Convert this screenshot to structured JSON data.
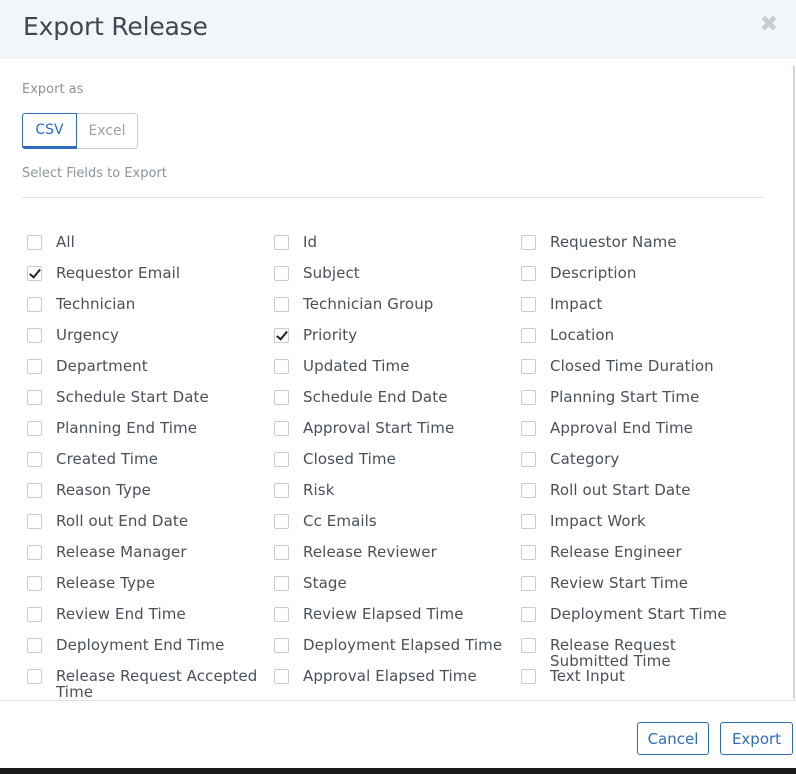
{
  "dialog": {
    "title": "Export Release",
    "close_icon": "close-icon"
  },
  "export_as": {
    "label": "Export as",
    "options": [
      "CSV",
      "Excel"
    ],
    "selected": "CSV"
  },
  "fields_section": {
    "label": "Select Fields to Export"
  },
  "fields": [
    [
      {
        "label": "All",
        "checked": false
      },
      {
        "label": "Id",
        "checked": false
      },
      {
        "label": "Requestor Name",
        "checked": false
      }
    ],
    [
      {
        "label": "Requestor Email",
        "checked": true
      },
      {
        "label": "Subject",
        "checked": false
      },
      {
        "label": "Description",
        "checked": false
      }
    ],
    [
      {
        "label": "Technician",
        "checked": false
      },
      {
        "label": "Technician Group",
        "checked": false
      },
      {
        "label": "Impact",
        "checked": false
      }
    ],
    [
      {
        "label": "Urgency",
        "checked": false
      },
      {
        "label": "Priority",
        "checked": true
      },
      {
        "label": "Location",
        "checked": false
      }
    ],
    [
      {
        "label": "Department",
        "checked": false
      },
      {
        "label": "Updated Time",
        "checked": false
      },
      {
        "label": "Closed Time Duration",
        "checked": false
      }
    ],
    [
      {
        "label": "Schedule Start Date",
        "checked": false
      },
      {
        "label": "Schedule End Date",
        "checked": false
      },
      {
        "label": "Planning Start Time",
        "checked": false
      }
    ],
    [
      {
        "label": "Planning End Time",
        "checked": false
      },
      {
        "label": "Approval Start Time",
        "checked": false
      },
      {
        "label": "Approval End Time",
        "checked": false
      }
    ],
    [
      {
        "label": "Created Time",
        "checked": false
      },
      {
        "label": "Closed Time",
        "checked": false
      },
      {
        "label": "Category",
        "checked": false
      }
    ],
    [
      {
        "label": "Reason Type",
        "checked": false
      },
      {
        "label": "Risk",
        "checked": false
      },
      {
        "label": "Roll out Start Date",
        "checked": false
      }
    ],
    [
      {
        "label": "Roll out End Date",
        "checked": false
      },
      {
        "label": "Cc Emails",
        "checked": false
      },
      {
        "label": "Impact Work",
        "checked": false
      }
    ],
    [
      {
        "label": "Release Manager",
        "checked": false
      },
      {
        "label": "Release Reviewer",
        "checked": false
      },
      {
        "label": "Release Engineer",
        "checked": false
      }
    ],
    [
      {
        "label": "Release Type",
        "checked": false
      },
      {
        "label": "Stage",
        "checked": false
      },
      {
        "label": "Review Start Time",
        "checked": false
      }
    ],
    [
      {
        "label": "Review End Time",
        "checked": false
      },
      {
        "label": "Review Elapsed Time",
        "checked": false
      },
      {
        "label": "Deployment Start Time",
        "checked": false
      }
    ],
    [
      {
        "label": "Deployment End Time",
        "checked": false
      },
      {
        "label": "Deployment Elapsed Time",
        "checked": false
      },
      {
        "label": "Release Request Submitted Time",
        "checked": false
      }
    ],
    [
      {
        "label": "Release Request Accepted Time",
        "checked": false
      },
      {
        "label": "Approval Elapsed Time",
        "checked": false
      },
      {
        "label": "Text Input",
        "checked": false
      }
    ]
  ],
  "footer": {
    "cancel_label": "Cancel",
    "export_label": "Export"
  },
  "colors": {
    "accent": "#2f6cc1",
    "header_bg": "#f2f6f9"
  }
}
